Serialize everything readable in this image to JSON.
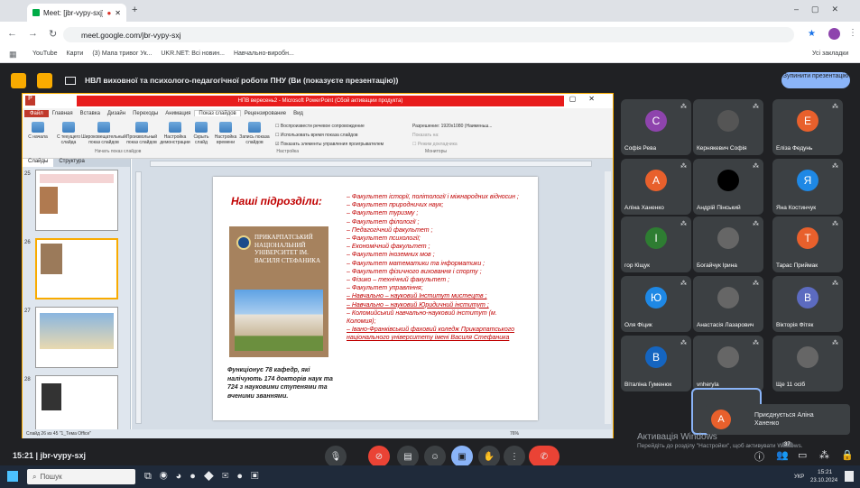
{
  "browser": {
    "tab_title": "Meet: [jbr-vypy-sxj]",
    "url": "meet.google.com/jbr-vypy-sxj",
    "bookmarks": [
      "YouTube",
      "Карти",
      "(3) Мапа тривог Ук...",
      "UKR.NET: Всі новин...",
      "Навчально-виробн..."
    ],
    "other_bookmarks": "Усі закладки"
  },
  "meet": {
    "presentation_title": "НВЛ виховної та психолого-педагогічної роботи ПНУ (Ви (показуєте презентацію))",
    "stop_button": "Зупинити презентацію",
    "time_code": "15:21  |  jbr-vypy-sxj",
    "joining_text": "Приєднується Аліна Ханенко",
    "joining_initial": "А",
    "activation_title": "Активація Windows",
    "activation_sub": "Перейдіть до розділу \"Настройки\", щоб активувати Windows.",
    "participants_count": "37"
  },
  "participants": [
    {
      "name": "Софія Рева",
      "initial": "С",
      "color": "#8e44ad"
    },
    {
      "name": "Кернякевич Софія",
      "initial": "",
      "color": "#555"
    },
    {
      "name": "Еліза Федунь",
      "initial": "Е",
      "color": "#e8602c"
    },
    {
      "name": "Аліна Ханенко",
      "initial": "А",
      "color": "#e8602c"
    },
    {
      "name": "Андрій Пінський",
      "initial": "",
      "color": "#000"
    },
    {
      "name": "Яна Костинчук",
      "initial": "Я",
      "color": "#1e88e5"
    },
    {
      "name": "гор Кіщук",
      "initial": "І",
      "color": "#2e7d32"
    },
    {
      "name": "Богайчук Ірина",
      "initial": "",
      "color": "#666"
    },
    {
      "name": "Тарас Приймак",
      "initial": "Т",
      "color": "#e8602c"
    },
    {
      "name": "Оля Фіцик",
      "initial": "Ю",
      "color": "#1e88e5"
    },
    {
      "name": "Анастасія Лазарович",
      "initial": "",
      "color": "#666"
    },
    {
      "name": "Вікторія Фітяк",
      "initial": "В",
      "color": "#5c6bc0"
    },
    {
      "name": "Віталіна Гуменюк",
      "initial": "В",
      "color": "#1565c0"
    },
    {
      "name": "vnheryla",
      "initial": "",
      "color": "#666"
    },
    {
      "name": "Ще 11 осіб",
      "initial": "",
      "color": "#666"
    }
  ],
  "ppt": {
    "window_title": "НПВ вересень2 - Microsoft PowerPoint (Сбой активации продукта)",
    "tabs": [
      "Файл",
      "Главная",
      "Вставка",
      "Дизайн",
      "Переходы",
      "Анимация",
      "Показ слайдов",
      "Рецензирование",
      "Вид"
    ],
    "ribbon_buttons": [
      "С начала",
      "С текущего слайда",
      "Широковещательный показ слайдов",
      "Произвольный показ слайдов",
      "Настройка демонстрации",
      "Скрыть слайд",
      "Настройка времени",
      "Запись показа слайдов"
    ],
    "group_start": "Начать показ слайдов",
    "group_setup": "Настройка",
    "group_monitors": "Мониторы",
    "checks": [
      "Воспроизвести речевое сопровождение",
      "Использовать время показа слайдов",
      "Показать элементы управления проигрывателем"
    ],
    "resolution": "Разрешение: 1920x1080 (Наименьш...",
    "show_on": "Показать на:",
    "presenter_mode": "Режим докладчика",
    "panel_tabs": [
      "Слайды",
      "Структура"
    ],
    "status": "Слайд 26 из 45   \"1_Тема Office\"",
    "zoom": "76%"
  },
  "slide": {
    "heading": "Наші підрозділи:",
    "university": "ПРИКАРПАТСЬКИЙ НАЦІОНАЛЬНИЙ УНІВЕРСИТЕТ ІМ. ВАСИЛЯ СТЕФАНИКА",
    "faculties": [
      "– Факультет історії, політології і міжнародних відносин ;",
      "– Факультет природничих наук;",
      "– Факультет туризму ;",
      "– Факультет філології ;",
      "– Педагогічний факультет ;",
      "– Факультет психології;",
      "– Економічний факультет ;",
      "– Факультет іноземних мов ;",
      "– Факультет математики та інформатики ;",
      "– Факультет фізичного виховання і спорту ;",
      "– Фізико – технічний факультет ;",
      "– Факультет управління;",
      "– Навчально – науковий Інститут мистецтв ;",
      "– Навчально – науковий Юридичний інститут ;",
      "– Коломийський навчально-науковий інститут (м. Коломия);",
      "– Івано-Франківський фаховий коледж Прикарпатського національного університету імені Василя Стефаника"
    ],
    "caption": "Функціонує 78 кафедр, які налічують 174 докторів наук та 724 з науковими ступенями та вченими званнями."
  },
  "thumbs": [
    {
      "num": "25"
    },
    {
      "num": "26"
    },
    {
      "num": "27"
    },
    {
      "num": "28"
    }
  ],
  "taskbar": {
    "search": "Пошук",
    "lang": "УКР",
    "time": "15:21",
    "date": "23.10.2024"
  }
}
